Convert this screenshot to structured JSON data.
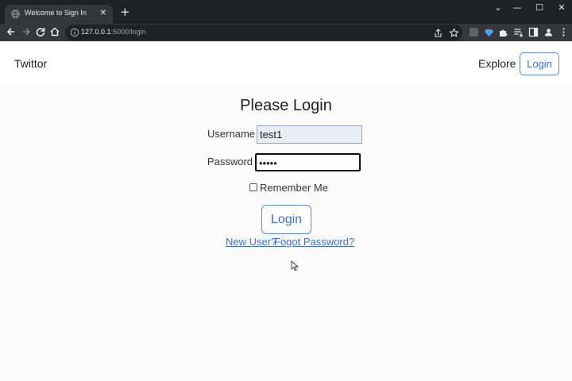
{
  "browser": {
    "tab_title": "Welcome to Sign In",
    "tab_close": "✕",
    "new_tab": "+",
    "url_host": "127.0.0.1",
    "url_rest": ":5000/login",
    "window_controls": [
      "⌄",
      "—",
      "☐",
      "✕"
    ]
  },
  "navbar": {
    "brand": "Twittor",
    "explore": "Explore",
    "login": "Login"
  },
  "form": {
    "heading": "Please Login",
    "username_label": "Username",
    "username_value": "test1",
    "password_label": "Password",
    "password_value": "•••••",
    "remember_label": "Remember Me",
    "remember_checked": false,
    "submit_label": "Login",
    "new_user_link": "New User?",
    "forgot_link": "Fogot Password?"
  },
  "colors": {
    "accent": "#3b6fd8",
    "chrome_dark": "#202124",
    "chrome_toolbar": "#35363a"
  }
}
